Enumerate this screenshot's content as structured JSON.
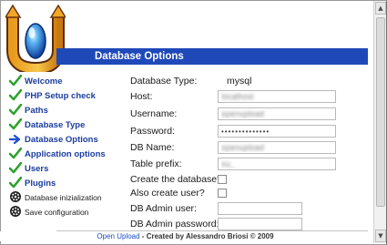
{
  "header": {
    "title": "Database Options"
  },
  "sidebar": {
    "steps": [
      {
        "label": "Welcome",
        "state": "done",
        "icon": "check-icon"
      },
      {
        "label": "PHP Setup check",
        "state": "done",
        "icon": "check-icon"
      },
      {
        "label": "Paths",
        "state": "done",
        "icon": "check-icon"
      },
      {
        "label": "Database Type",
        "state": "done",
        "icon": "check-icon"
      },
      {
        "label": "Database Options",
        "state": "current",
        "icon": "arrow-right-icon"
      },
      {
        "label": "Application options",
        "state": "done",
        "icon": "check-icon"
      },
      {
        "label": "Users",
        "state": "done",
        "icon": "check-icon"
      },
      {
        "label": "Plugins",
        "state": "done",
        "icon": "check-icon"
      },
      {
        "label": "Database inizialization",
        "state": "pending",
        "icon": "gear-icon"
      },
      {
        "label": "Save configuration",
        "state": "pending",
        "icon": "gear-icon"
      }
    ]
  },
  "form": {
    "db_type_label": "Database Type:",
    "db_type_value": "mysql",
    "host_label": "Host:",
    "host_value": "localhost",
    "username_label": "Username:",
    "username_value": "openupload",
    "password_label": "Password:",
    "password_value": "••••••••••••••",
    "dbname_label": "DB Name:",
    "dbname_value": "openupload",
    "prefix_label": "Table prefix:",
    "prefix_value": "ou_",
    "create_db_label": "Create the database?",
    "create_user_label": "Also create user?",
    "admin_user_label": "DB Admin user:",
    "admin_user_value": "",
    "admin_password_label": "DB Admin password:",
    "admin_password_value": ""
  },
  "footer": {
    "link": "Open Upload",
    "credit": " - Created by Alessandro Briosi © 2009"
  },
  "colors": {
    "header_bar": "#1f49b8",
    "step_text": "#1a3d9e",
    "check_green": "#2ea12e",
    "arrow_blue": "#1e4fd0"
  }
}
